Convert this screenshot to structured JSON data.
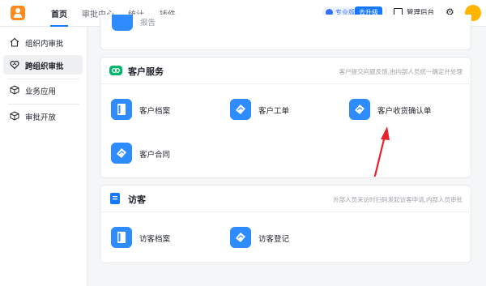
{
  "topbar": {
    "tabs": [
      {
        "label": "首页"
      },
      {
        "label": "审批中心"
      },
      {
        "label": "统计"
      },
      {
        "label": "插件"
      }
    ],
    "pro_label": "专业版",
    "upgrade_label": "去升级",
    "admin_label": "管理后台"
  },
  "sidebar": {
    "items": [
      {
        "label": "组织内审批"
      },
      {
        "label": "跨组织审批"
      },
      {
        "label": "业务应用"
      },
      {
        "label": "审批开放"
      }
    ]
  },
  "partial_card": {
    "tile_label": "报告"
  },
  "customer_service": {
    "title": "客户服务",
    "description": "客户提交问题反馈,由内部人员统一确定并处理",
    "tiles": [
      {
        "label": "客户档案"
      },
      {
        "label": "客户工单"
      },
      {
        "label": "客户收货确认单"
      },
      {
        "label": "客户合同"
      }
    ]
  },
  "visitor": {
    "title": "访客",
    "description": "外部人员来访时扫码发起访客申请,内部人员审批",
    "tiles": [
      {
        "label": "访客档案"
      },
      {
        "label": "访客登记"
      }
    ]
  },
  "colors": {
    "accent": "#1677ff",
    "tile_icon": "#2f8cff",
    "section_icon_green": "#00b86b",
    "annotation_arrow": "#e8212d"
  }
}
